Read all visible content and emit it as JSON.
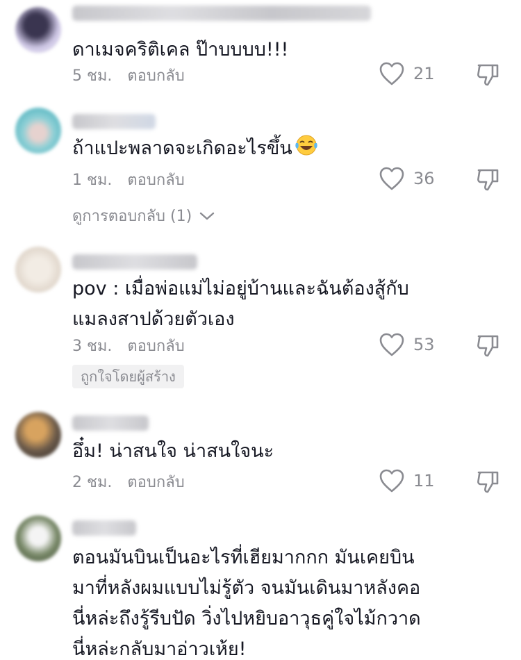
{
  "comments": [
    {
      "text_lines": [
        "ดาเมจคริติเคล ป๊าบบบบ!!!"
      ],
      "time": "5 ชม.",
      "reply_label": "ตอบกลับ",
      "likes": "21"
    },
    {
      "text_lines": [
        "ถ้าแปะพลาดจะเกิดอะไรขึ้น"
      ],
      "time": "1 ชม.",
      "reply_label": "ตอบกลับ",
      "likes": "36",
      "view_replies": "ดูการตอบกลับ (1)"
    },
    {
      "text_lines": [
        "pov : เมื่อพ่อแม่ไม่อยู่บ้านและฉันต้องสู้กับ",
        "แมลงสาปด้วยตัวเอง"
      ],
      "time": "3 ชม.",
      "reply_label": "ตอบกลับ",
      "likes": "53",
      "badge": "ถูกใจโดยผู้สร้าง"
    },
    {
      "text_lines": [
        "อึ๋ม! น่าสนใจ น่าสนใจนะ"
      ],
      "time": "2 ชม.",
      "reply_label": "ตอบกลับ",
      "likes": "11"
    },
    {
      "text_lines": [
        "ตอนมันบินเป็นอะไรที่เฮียมากกก มันเคยบิน",
        "มาที่หลังผมแบบไม่รู้ตัว จนมันเดินมาหลังคอ",
        "นี่หล่ะถึงรู้รีบปัด วิ่งไปหยิบอาวุธคู่ใจไม้กวาด",
        "นี่หล่ะกลับมาอ่าวเห้ย!"
      ]
    }
  ],
  "icons": {
    "like": "heart-outline-icon",
    "dislike": "thumbs-down-icon",
    "expand": "chevron-down-icon",
    "emoji": "laughing-tears-emoji"
  },
  "colors": {
    "text": "#161823",
    "secondary": "#8a8b91",
    "badge_bg": "#f1f1f2"
  }
}
